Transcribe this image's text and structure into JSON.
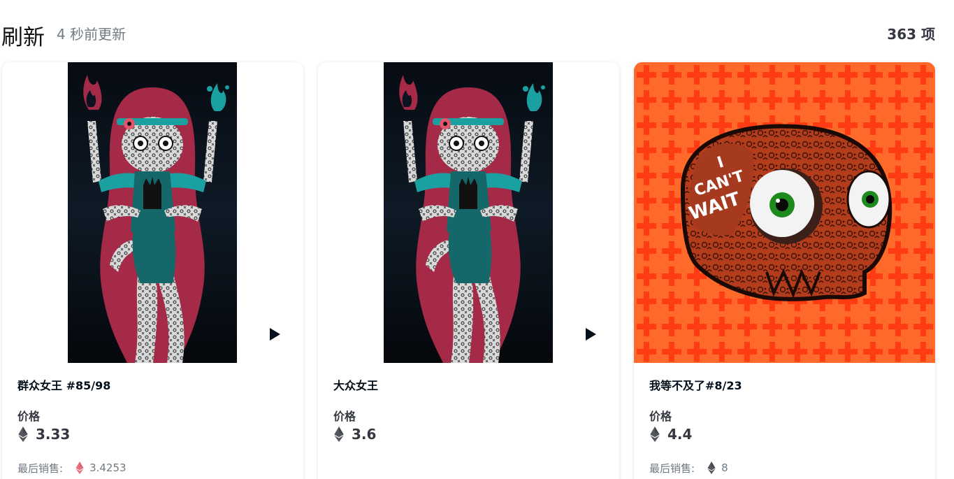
{
  "toolbar": {
    "refresh_label": "刷新",
    "updated_text": "4 秒前更新",
    "item_count": "363 项"
  },
  "cards": [
    {
      "title": "群众女王 #85/98",
      "price_label": "价格",
      "price": "3.33",
      "last_sale_label": "最后销售:",
      "last_sale_value": "3.4253",
      "last_sale_currency_color": "#e2566a",
      "media": "girl-artwork",
      "has_video": true
    },
    {
      "title": "大众女王",
      "price_label": "价格",
      "price": "3.6",
      "media": "girl-artwork",
      "has_video": true
    },
    {
      "title": "我等不及了#8/23",
      "price_label": "价格",
      "price": "4.4",
      "last_sale_label": "最后销售:",
      "last_sale_value": "8",
      "last_sale_currency_color": "#353840",
      "media": "skull-artwork",
      "media_background": "#ff5a1f",
      "has_video": false
    }
  ],
  "colors": {
    "text_primary": "#04111d",
    "text_secondary": "#707a83",
    "artwork_hair": "#a52a48",
    "artwork_teal": "#1aa0a0",
    "artwork_background": "#0b1320"
  },
  "icons": {
    "currency": "ethereum-icon",
    "play": "play-icon"
  }
}
